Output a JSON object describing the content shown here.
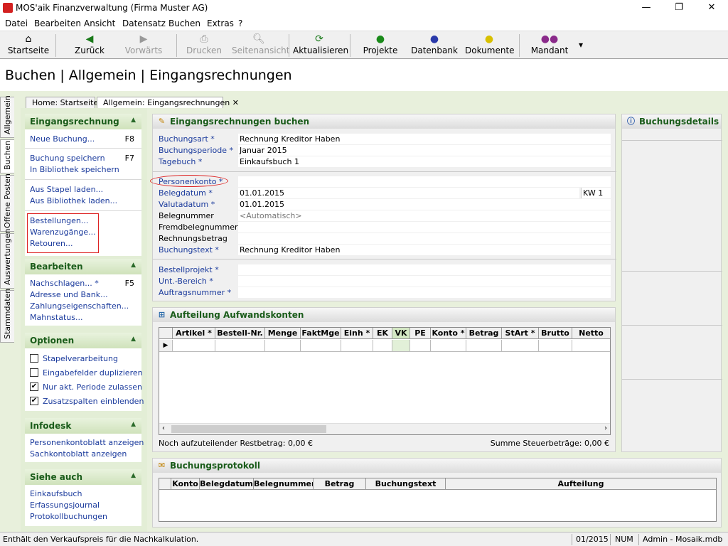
{
  "window": {
    "title": "MOS'aik Finanzverwaltung (Firma Muster AG)",
    "min": "—",
    "max": "❐",
    "close": "✕"
  },
  "menu": [
    "Datei",
    "Bearbeiten",
    "Ansicht",
    "Datensatz",
    "Buchen",
    "Extras",
    "?"
  ],
  "toolbar": {
    "startseite": "Startseite",
    "zurueck": "Zurück",
    "vorwaerts": "Vorwärts",
    "drucken": "Drucken",
    "seitenansicht": "Seitenansicht",
    "aktualisieren": "Aktualisieren",
    "projekte": "Projekte",
    "datenbank": "Datenbank",
    "dokumente": "Dokumente",
    "mandant": "Mandant"
  },
  "page_title": "Buchen | Allgemein | Eingangsrechnungen",
  "vtabs": [
    "Allgemein",
    "Buchen",
    "Offene Posten",
    "Auswertungen",
    "Stammdaten"
  ],
  "doctabs": {
    "home": "Home: Startseite",
    "active": "Allgemein: Eingangsrechnungen"
  },
  "left": {
    "eingangsrechnung": {
      "title": "Eingangsrechnung",
      "neue": "Neue Buchung...",
      "neue_key": "F8",
      "speichern": "Buchung speichern",
      "speichern_key": "F7",
      "bibliothek_speichern": "In Bibliothek speichern",
      "stapel": "Aus Stapel laden...",
      "bibliothek_laden": "Aus Bibliothek laden...",
      "bestellungen": "Bestellungen...",
      "warenzugaenge": "Warenzugänge...",
      "retouren": "Retouren..."
    },
    "bearbeiten": {
      "title": "Bearbeiten",
      "nachschlagen": "Nachschlagen... *",
      "nachschlagen_key": "F5",
      "adresse": "Adresse und Bank...",
      "zahlung": "Zahlungseigenschaften...",
      "mahnstatus": "Mahnstatus..."
    },
    "optionen": {
      "title": "Optionen",
      "stapel": "Stapelverarbeitung",
      "duplizieren": "Eingabefelder duplizieren",
      "periode": "Nur akt. Periode zulassen",
      "zusatz": "Zusatzspalten einblenden"
    },
    "infodesk": {
      "title": "Infodesk",
      "personen": "Personenkontoblatt anzeigen",
      "sach": "Sachkontoblatt anzeigen"
    },
    "siehe": {
      "title": "Siehe auch",
      "einkauf": "Einkaufsbuch",
      "erfassung": "Erfassungsjournal",
      "protokoll": "Protokollbuchungen"
    }
  },
  "form": {
    "title": "Eingangsrechnungen buchen",
    "buchungsart": {
      "label": "Buchungsart *",
      "value": "Rechnung Kreditor Haben"
    },
    "periode": {
      "label": "Buchungsperiode *",
      "value": "Januar 2015"
    },
    "tagebuch": {
      "label": "Tagebuch *",
      "value": "Einkaufsbuch 1"
    },
    "personenkonto": {
      "label": "Personenkonto *",
      "value": ""
    },
    "belegdatum": {
      "label": "Belegdatum *",
      "value": "01.01.2015",
      "kw": "KW 1"
    },
    "valutadatum": {
      "label": "Valutadatum *",
      "value": "01.01.2015"
    },
    "belegnummer": {
      "label": "Belegnummer",
      "value": "<Automatisch>"
    },
    "fremdbeleg": {
      "label": "Fremdbelegnummer",
      "value": ""
    },
    "betrag": {
      "label": "Rechnungsbetrag",
      "value": ""
    },
    "buchungstext": {
      "label": "Buchungstext *",
      "value": "Rechnung Kreditor Haben"
    },
    "bestellprojekt": {
      "label": "Bestellprojekt *",
      "value": ""
    },
    "unt_bereich": {
      "label": "Unt.-Bereich *",
      "value": ""
    },
    "auftrag": {
      "label": "Auftragsnummer *",
      "value": ""
    }
  },
  "details": {
    "title": "Buchungsdetails"
  },
  "aufteilung": {
    "title": "Aufteilung Aufwandskonten",
    "columns": [
      "Artikel *",
      "Bestell-Nr.",
      "Menge",
      "FaktMge",
      "Einh *",
      "EK",
      "VK",
      "PE",
      "Konto *",
      "Betrag",
      "StArt *",
      "Brutto",
      "Netto"
    ],
    "restbetrag": "Noch aufzuteilender Restbetrag: 0,00 €",
    "steuer": "Summe Steuerbeträge: 0,00 €"
  },
  "protokoll": {
    "title": "Buchungsprotokoll",
    "columns": [
      "Konto",
      "Belegdatum",
      "Belegnummer",
      "Betrag",
      "Buchungstext",
      "Aufteilung"
    ]
  },
  "status": {
    "text": "Enthält den Verkaufspreis für die Nachkalkulation.",
    "periode": "01/2015",
    "num": "NUM",
    "db": "Admin - Mosaik.mdb"
  },
  "colors": {
    "green_header": "#1a5c1a",
    "link_blue": "#1a3a9c",
    "panel_bg": "#e8f0dc"
  }
}
